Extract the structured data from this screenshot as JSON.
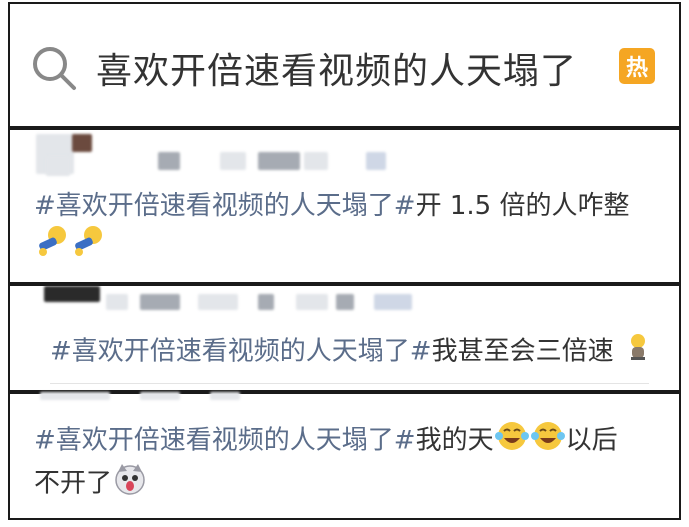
{
  "search": {
    "query": "喜欢开倍速看视频的人天塌了",
    "badge": "热"
  },
  "posts": [
    {
      "tag": "#喜欢开倍速看视频的人天塌了#",
      "text": "开 1.5 倍的人咋整",
      "emojis": [
        "kneel-emoji",
        "kneel-emoji"
      ]
    },
    {
      "tag": "#喜欢开倍速看视频的人天塌了#",
      "text": "我甚至会三倍速",
      "emojis": [
        "sad-figure-emoji"
      ]
    },
    {
      "tag": "#喜欢开倍速看视频的人天塌了#",
      "text_a": "我的天",
      "text_b": "以后",
      "text_c": "不开了",
      "emojis": [
        "laugh-cry-emoji",
        "laugh-cry-emoji",
        "husky-emoji"
      ]
    }
  ],
  "colors": {
    "tag": "#5b6d8a",
    "text": "#333333",
    "badge": "#f5a623"
  }
}
